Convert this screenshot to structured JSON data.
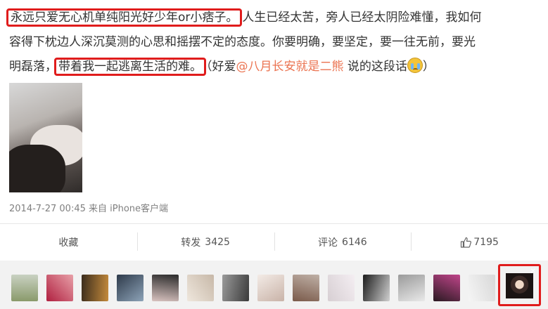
{
  "post": {
    "line1_hl": "永远只爱无心机单纯阳光好少年or小痞子。",
    "line1_rest": "人生已经太苦，旁人已经太阴险难懂，我如何",
    "line2": "容得下枕边人深沉莫测的心思和摇摆不定的态度。你要明确，要坚定，要一往无前，要光",
    "line3_pre": "明磊落，",
    "line3_hl": "带着我一起逃离生活的难。",
    "line3_paren_open": "（好爱",
    "line3_mention": "@八月长安就是二熊",
    "line3_after": " 说的这段话",
    "line3_paren_close": "）",
    "emoji": "crying-face"
  },
  "meta": "2014-7-27 00:45 来自 iPhone客户端",
  "actions": [
    {
      "label": "收藏",
      "count": ""
    },
    {
      "label": "转发",
      "count": "3425"
    },
    {
      "label": "评论",
      "count": "6146"
    },
    {
      "label": "",
      "count": "7195"
    }
  ],
  "colors": {
    "highlight": "#e01c1c",
    "mention": "#eb7350",
    "text": "#333333",
    "meta": "#808080"
  },
  "avatars": [
    {
      "colors": [
        "#8a9a6b",
        "#c9d1c2"
      ]
    },
    {
      "colors": [
        "#b02040",
        "#e8a0a8"
      ]
    },
    {
      "colors": [
        "#3a2c1d",
        "#c48a3b"
      ]
    },
    {
      "colors": [
        "#2e3a4a",
        "#8da3b8"
      ]
    },
    {
      "colors": [
        "#2a2a2a",
        "#d9c3c0"
      ]
    },
    {
      "colors": [
        "#c7b8a8",
        "#efe7dd"
      ]
    },
    {
      "colors": [
        "#3a3a3a",
        "#9a9a9a"
      ]
    },
    {
      "colors": [
        "#c9b3a8",
        "#f3ebe6"
      ]
    },
    {
      "colors": [
        "#7a5a4a",
        "#bfb0a6"
      ]
    },
    {
      "colors": [
        "#d7cfd3",
        "#f4eef2"
      ]
    },
    {
      "colors": [
        "#1c1c1c",
        "#d0d0d0"
      ]
    },
    {
      "colors": [
        "#9a9a9a",
        "#e9e9e9"
      ]
    },
    {
      "colors": [
        "#c0458a",
        "#2a1a22"
      ]
    },
    {
      "colors": [
        "#d8d8d8",
        "#f5f5f5"
      ]
    }
  ]
}
